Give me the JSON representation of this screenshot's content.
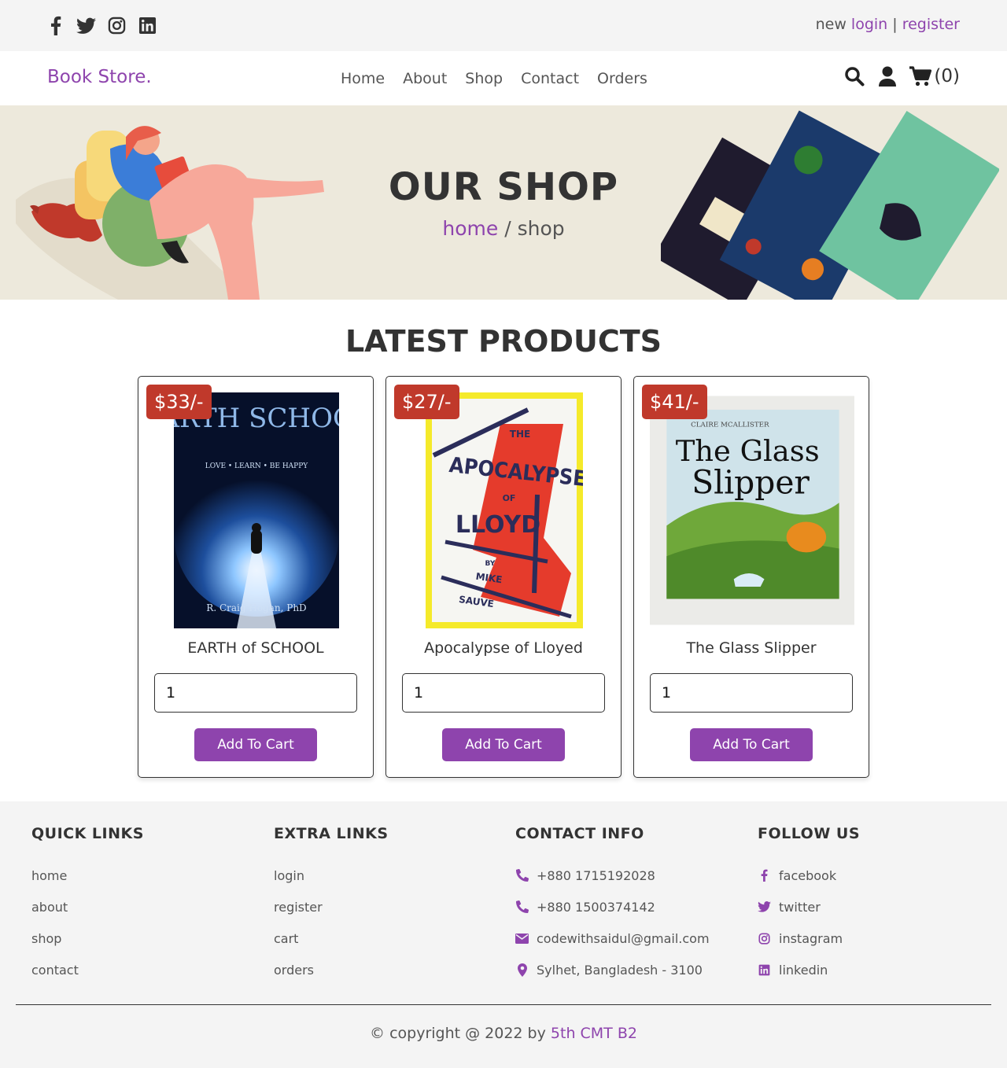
{
  "topbar": {
    "socials": [
      "facebook-icon",
      "twitter-icon",
      "instagram-icon",
      "linkedin-icon"
    ],
    "auth_prefix": "new",
    "login": "login",
    "separator": "|",
    "register": "register"
  },
  "header": {
    "logo": "Book Store.",
    "nav": [
      "Home",
      "About",
      "Shop",
      "Contact",
      "Orders"
    ],
    "cart_count": "(0)"
  },
  "hero": {
    "title": "OUR SHOP",
    "crumb_home": "home",
    "crumb_sep": " / ",
    "crumb_current": "shop"
  },
  "products": {
    "title": "LATEST PRODUCTS",
    "items": [
      {
        "price": "$33/-",
        "name": "EARTH of SCHOOL",
        "qty": "1",
        "button": "Add To Cart",
        "cover_title": "EARTH SCHOOL",
        "cover_sub": "LOVE • LEARN • BE HAPPY",
        "cover_author": "R. Craig Hogan, PhD"
      },
      {
        "price": "$27/-",
        "name": "Apocalypse of Lloyed",
        "qty": "1",
        "button": "Add To Cart",
        "cover_the": "THE",
        "cover_title": "APOCALYPSE",
        "cover_of": "OF",
        "cover_name": "LLOYD",
        "cover_by": "BY",
        "cover_author1": "MIKE",
        "cover_author2": "SAUVE"
      },
      {
        "price": "$41/-",
        "name": "The Glass Slipper",
        "qty": "1",
        "button": "Add To Cart",
        "cover_author": "CLAIRE MCALLISTER",
        "cover_title1": "The Glass",
        "cover_title2": "Slipper"
      }
    ]
  },
  "footer": {
    "quick": {
      "title": "QUICK LINKS",
      "links": [
        "home",
        "about",
        "shop",
        "contact"
      ]
    },
    "extra": {
      "title": "EXTRA LINKS",
      "links": [
        "login",
        "register",
        "cart",
        "orders"
      ]
    },
    "contact": {
      "title": "CONTACT INFO",
      "items": [
        "+880 1715192028",
        "+880 1500374142",
        "codewithsaidul@gmail.com",
        "Sylhet, Bangladesh - 3100"
      ]
    },
    "follow": {
      "title": "FOLLOW US",
      "items": [
        "facebook",
        "twitter",
        "instagram",
        "linkedin"
      ]
    },
    "credit_prefix": "© copyright @ 2022 by ",
    "credit_name": "5th CMT B2"
  },
  "colors": {
    "accent": "#8e44ad",
    "price_bg": "#c0392b",
    "hero_bg": "#ede9dc",
    "footer_bg": "#f4f4f4"
  }
}
